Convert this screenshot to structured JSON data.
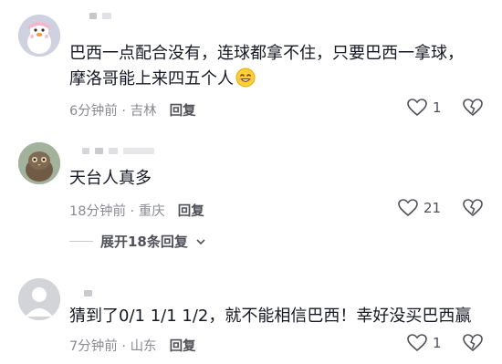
{
  "comments": [
    {
      "text_line1": "巴西一点配合没有，连球都拿不住，只要巴西一拿球，",
      "text_line2": "摩洛哥能上来四五个人",
      "time": "6分钟前",
      "location": "吉林",
      "reply_label": "回复",
      "likes": "1",
      "emoji_icon": "grinning-emoji"
    },
    {
      "text_line1": "天台人真多",
      "time": "18分钟前",
      "location": "重庆",
      "reply_label": "回复",
      "likes": "21"
    },
    {
      "text_line1": "猜到了0/1 1/1 1/2，就不能相信巴西！幸好没买巴西赢",
      "time": "7分钟前",
      "location": "山东",
      "reply_label": "回复",
      "likes": "1"
    }
  ],
  "expand_replies": "展开18条回复"
}
